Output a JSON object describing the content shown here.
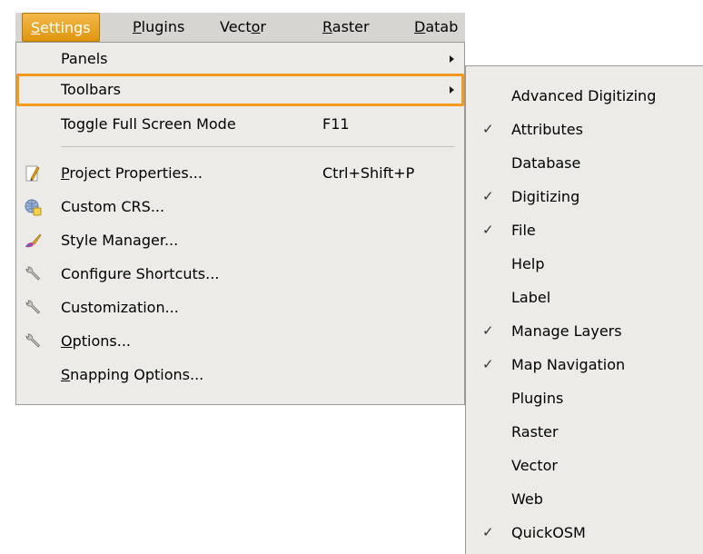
{
  "menubar": {
    "items": [
      {
        "label": "Settings",
        "mnemonic": "S",
        "rest": "ettings",
        "active": true
      },
      {
        "label": "Plugins",
        "mnemonic": "P",
        "rest": "lugins"
      },
      {
        "label": "Vector",
        "pre": "Vect",
        "mnemonic": "o",
        "rest": "r"
      },
      {
        "label": "Raster",
        "mnemonic": "R",
        "rest": "aster"
      },
      {
        "label": "Datab",
        "mnemonic": "D",
        "rest": "atab"
      }
    ]
  },
  "settings_menu": {
    "items": [
      {
        "label": "Panels",
        "submenu": true
      },
      {
        "label": "Toolbars",
        "submenu": true,
        "highlighted": true
      },
      {
        "label": "Toggle Full Screen Mode",
        "shortcut": "F11"
      },
      {
        "label_mn": "P",
        "label_rest": "roject Properties...",
        "shortcut": "Ctrl+Shift+P",
        "icon": "project-properties-icon"
      },
      {
        "label": "Custom CRS...",
        "icon": "custom-crs-globe-icon"
      },
      {
        "label": "Style Manager...",
        "icon": "style-manager-brush-icon"
      },
      {
        "label": "Configure Shortcuts...",
        "icon": "wrench-icon"
      },
      {
        "label": "Customization...",
        "icon": "wrench-icon"
      },
      {
        "label_mn": "O",
        "label_rest": "ptions...",
        "icon": "wrench-icon"
      },
      {
        "label_mn": "S",
        "label_rest": "napping Options..."
      }
    ]
  },
  "toolbars_submenu": {
    "check_glyph": "✓",
    "items": [
      {
        "label": "Advanced Digitizing",
        "checked": false
      },
      {
        "label": "Attributes",
        "checked": true
      },
      {
        "label": "Database",
        "checked": false
      },
      {
        "label": "Digitizing",
        "checked": true
      },
      {
        "label": "File",
        "checked": true
      },
      {
        "label": "Help",
        "checked": false
      },
      {
        "label": "Label",
        "checked": false
      },
      {
        "label": "Manage Layers",
        "checked": true
      },
      {
        "label": "Map Navigation",
        "checked": true
      },
      {
        "label": "Plugins",
        "checked": false
      },
      {
        "label": "Raster",
        "checked": false
      },
      {
        "label": "Vector",
        "checked": false
      },
      {
        "label": "Web",
        "checked": false
      },
      {
        "label": "QuickOSM",
        "checked": true
      }
    ]
  },
  "colors": {
    "menu_bg": "#ecebe8",
    "menubar_bg": "#d6d5d1",
    "active_menu": "#e9a526",
    "highlight_outline": "#f39a1e"
  }
}
